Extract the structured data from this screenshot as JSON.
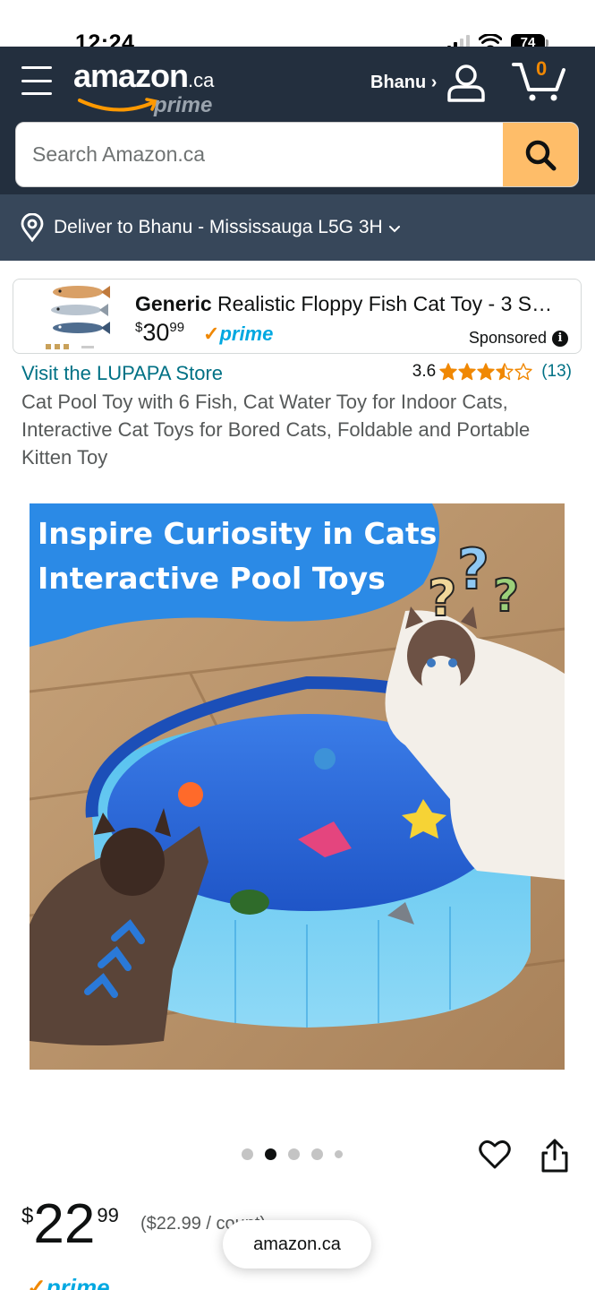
{
  "status_bar": {
    "time": "12:24",
    "battery": "74"
  },
  "header": {
    "logo_text": "amazon",
    "logo_suffix": ".ca",
    "logo_prime": "prime",
    "account_label": "Bhanu ›",
    "cart_count": "0"
  },
  "search": {
    "placeholder": "Search Amazon.ca"
  },
  "delivery": {
    "text": "Deliver to Bhanu - Mississauga L5G 3H"
  },
  "sponsored_ad": {
    "brand": "Generic",
    "title": " Realistic Floppy Fish Cat Toy - 3 S…",
    "price_symbol": "$",
    "price_whole": "30",
    "price_fraction": "99",
    "prime_label": "prime",
    "sponsored_label": "Sponsored"
  },
  "product": {
    "store_link": "Visit the LUPAPA Store",
    "rating_value": "3.6",
    "rating_stars": 3.5,
    "rating_count": "(13)",
    "title": "Cat Pool Toy with 6 Fish, Cat Water Toy for Indoor Cats, Interactive Cat Toys for Bored Cats, Foldable and Portable Kitten Toy",
    "image_banner_line1": "Inspire Curiosity in Cats",
    "image_banner_line2": "Interactive Pool Toys"
  },
  "carousel": {
    "total_dots": 5,
    "active_index": 1
  },
  "pricing": {
    "symbol": "$",
    "whole": "22",
    "fraction": "99",
    "unit_price": "($22.99 / count)",
    "prime_label": "prime"
  },
  "toast": {
    "text": "amazon.ca"
  },
  "colors": {
    "header_bg": "#232f3e",
    "delivery_bg": "#37475a",
    "search_button": "#febd69",
    "link": "#007185",
    "star": "#f08804",
    "prime_blue": "#00a8e1"
  },
  "icons": [
    "menu-icon",
    "user-icon",
    "cart-icon",
    "search-icon",
    "location-pin-icon",
    "chevron-down-icon",
    "info-icon",
    "heart-icon",
    "share-icon",
    "star-icon"
  ]
}
